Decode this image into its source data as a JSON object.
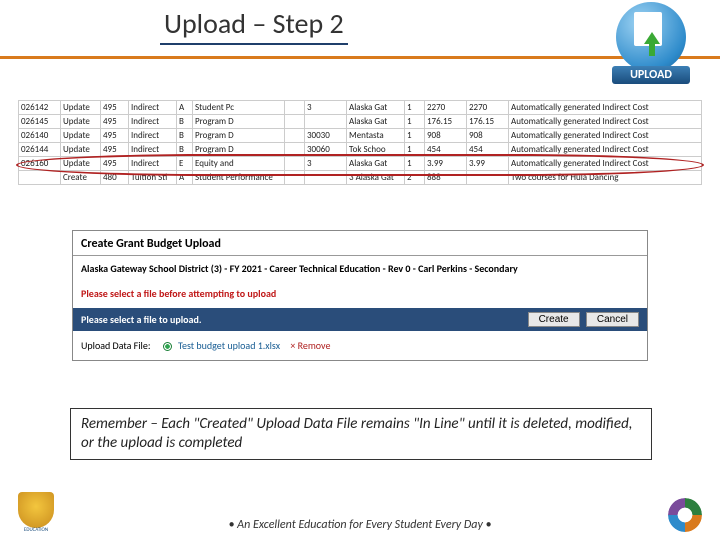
{
  "title": "Upload – Step 2",
  "upload_icon_label": "UPLOAD",
  "sheet_rows": [
    {
      "id": "026142",
      "act": "Update",
      "c3": "495",
      "c4": "Indirect",
      "c5": "A",
      "c6": "Student Pc",
      "c7": "",
      "c8": "3",
      "c9": "Alaska Gat",
      "c10": "1",
      "c11": "2270",
      "c12": "2270",
      "c13": "Automatically generated Indirect Cost"
    },
    {
      "id": "026145",
      "act": "Update",
      "c3": "495",
      "c4": "Indirect",
      "c5": "B",
      "c6": "Program D",
      "c7": "",
      "c8": "",
      "c9": "Alaska Gat",
      "c10": "1",
      "c11": "176.15",
      "c12": "176.15",
      "c13": "Automatically generated Indirect Cost"
    },
    {
      "id": "026140",
      "act": "Update",
      "c3": "495",
      "c4": "Indirect",
      "c5": "B",
      "c6": "Program D",
      "c7": "",
      "c8": "30030",
      "c9": "Mentasta",
      "c10": "1",
      "c11": "908",
      "c12": "908",
      "c13": "Automatically generated Indirect Cost"
    },
    {
      "id": "026144",
      "act": "Update",
      "c3": "495",
      "c4": "Indirect",
      "c5": "B",
      "c6": "Program D",
      "c7": "",
      "c8": "30060",
      "c9": "Tok Schoo",
      "c10": "1",
      "c11": "454",
      "c12": "454",
      "c13": "Automatically generated Indirect Cost"
    },
    {
      "id": "026160",
      "act": "Update",
      "c3": "495",
      "c4": "Indirect",
      "c5": "E",
      "c6": "Equity and",
      "c7": "",
      "c8": "3",
      "c9": "Alaska Gat",
      "c10": "1",
      "c11": "3.99",
      "c12": "3.99",
      "c13": "Automatically generated Indirect Cost"
    },
    {
      "id": "",
      "act": "Create",
      "c3": "480",
      "c4": "Tuition Sti",
      "c5": "A",
      "c6": "Student Performance",
      "c7": "",
      "c8": "",
      "c9": "3 Alaska Gat",
      "c10": "2",
      "c11": "888",
      "c12": "",
      "c13": "Two courses for Hula Dancing"
    }
  ],
  "panel": {
    "title": "Create Grant Budget Upload",
    "subtitle": "Alaska Gateway School District (3) - FY 2021 - Career Technical Education - Rev 0 - Carl Perkins - Secondary",
    "warning": "Please select a file before attempting to upload",
    "bar_text": "Please select a file to upload.",
    "create_btn": "Create",
    "cancel_btn": "Cancel",
    "file_label": "Upload Data File:",
    "file_name": "Test budget upload 1.xlsx",
    "remove": "Remove"
  },
  "note": "Remember – Each \"Created\" Upload Data File remains \"In Line\" until it is deleted, modified, or the upload is completed",
  "footer": {
    "center": "• An Excellent Education for Every Student Every Day •",
    "left_label": "EDUCATION"
  }
}
